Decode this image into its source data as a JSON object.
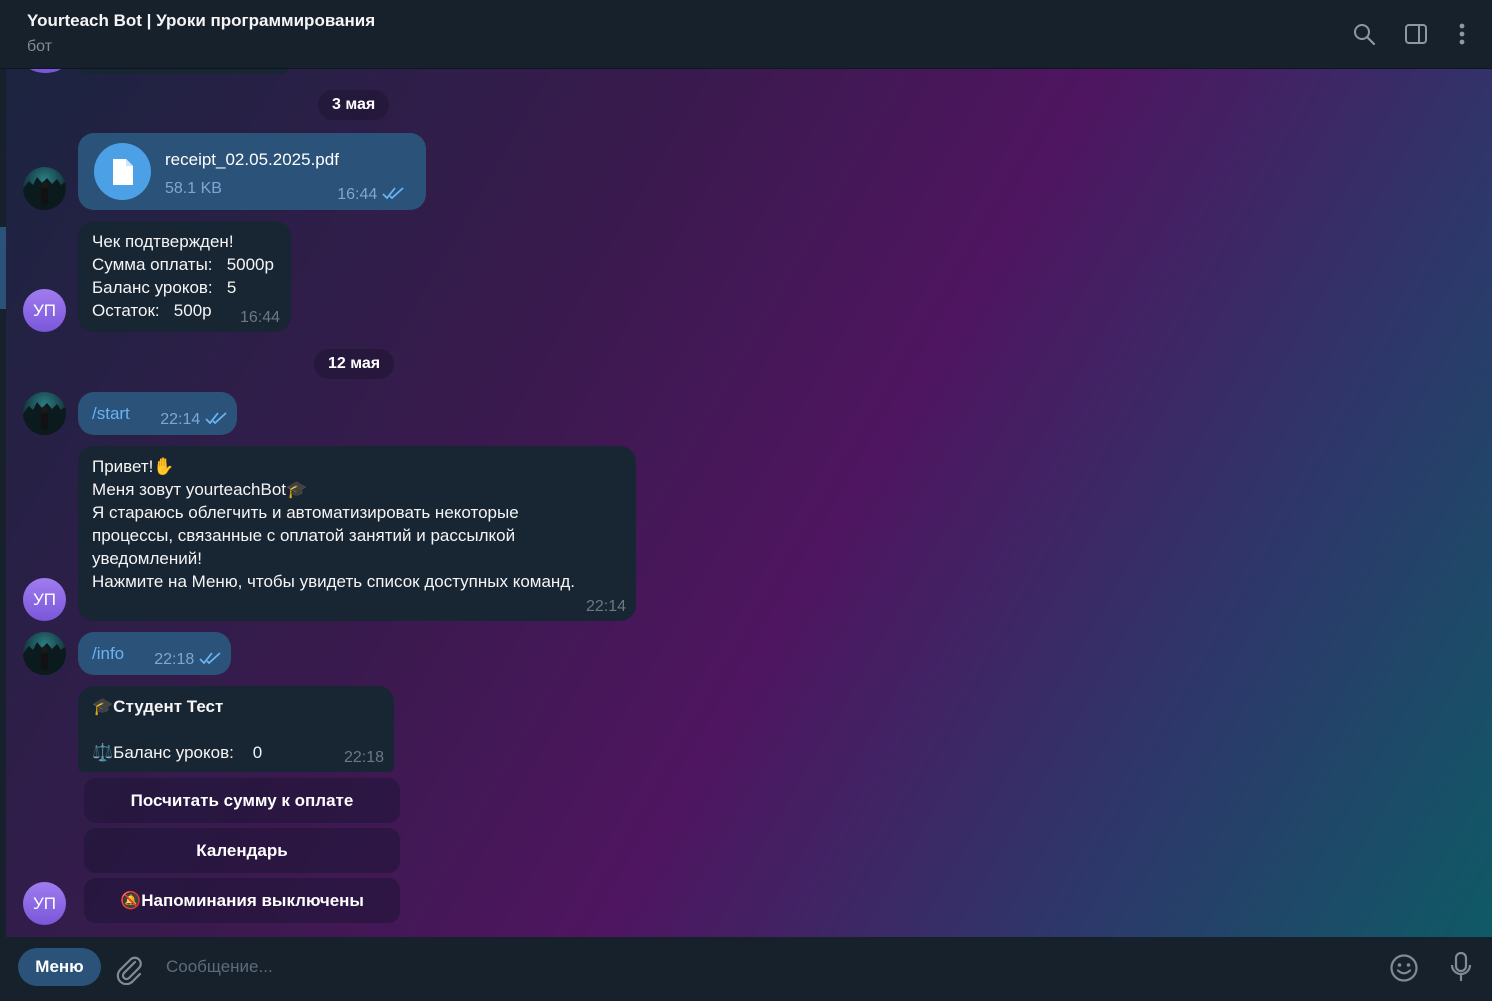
{
  "header": {
    "title": "Yourteach Bot | Уроки программирования",
    "subtitle": "бот",
    "icons": [
      "search-icon",
      "sidebar-toggle-icon",
      "more-vertical-icon"
    ]
  },
  "dates": [
    "3 мая",
    "12 мая"
  ],
  "avatars": {
    "bot_initials": "УП"
  },
  "messages": {
    "file": {
      "name": "receipt_02.05.2025.pdf",
      "size": "58.1 KB",
      "time": "16:44"
    },
    "receipt": {
      "lines": [
        "Чек подтвержден!",
        "Сумма оплаты:   5000р",
        "Баланс уроков:   5",
        "Остаток:   500р"
      ],
      "time": "16:44"
    },
    "start": {
      "text": "/start",
      "time": "22:14"
    },
    "welcome": {
      "lines": [
        "Привет!✋",
        "Меня зовут yourteachBot🎓",
        "Я стараюсь облегчить и автоматизировать некоторые",
        "процессы, связанные с оплатой занятий и рассылкой",
        "уведомлений!",
        "Нажмите на Меню, чтобы увидеть список доступных команд."
      ],
      "time": "22:14"
    },
    "info": {
      "text": "/info",
      "time": "22:18"
    },
    "profile": {
      "name_line": "🎓Студент Тест",
      "balance_line": "⚖️Баланс уроков:    0",
      "time": "22:18"
    }
  },
  "keyboard": {
    "buttons": [
      "Посчитать сумму к оплате",
      "Календарь",
      "🔕Напоминания выключены"
    ]
  },
  "input": {
    "menu_label": "Меню",
    "placeholder": "Сообщение..."
  },
  "colors": {
    "panel": "#17212b",
    "outgoing_bubble": "#2b5278",
    "incoming_bubble": "#182533",
    "accent": "#6ab3f3",
    "file_icon": "#4ca0e6"
  }
}
